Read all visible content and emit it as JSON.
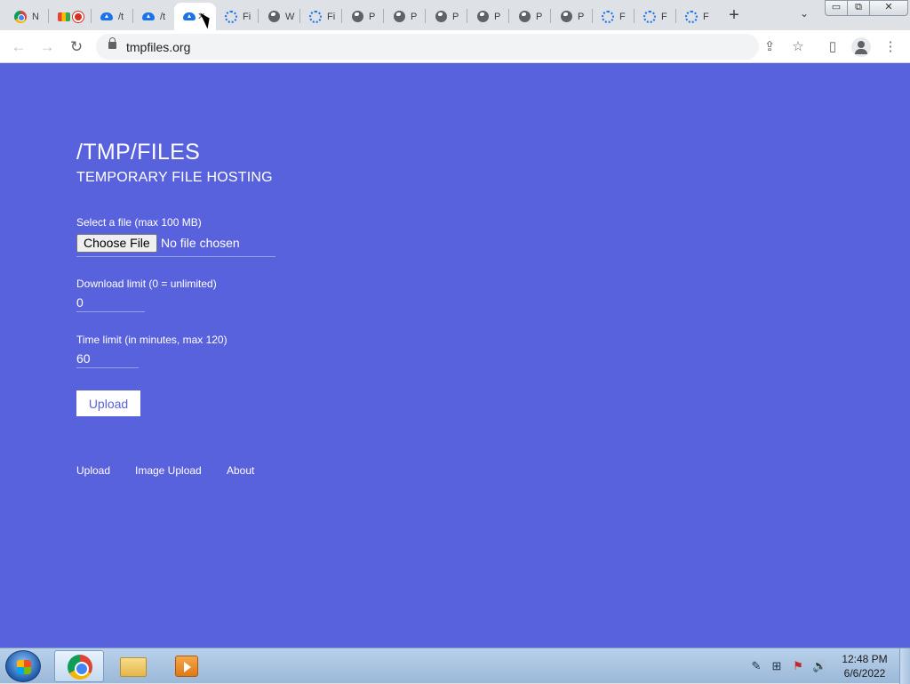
{
  "browser": {
    "tabs": [
      {
        "icon": "chrome-icon",
        "title": "N"
      },
      {
        "icon": "meet-icon",
        "title": ""
      },
      {
        "icon": "cloud-upload-icon",
        "title": "/t"
      },
      {
        "icon": "cloud-upload-icon",
        "title": "/t"
      },
      {
        "icon": "cloud-upload-icon",
        "title": "",
        "active": true,
        "close": "✕"
      },
      {
        "icon": "loading-icon",
        "title": "Fi"
      },
      {
        "icon": "globe-icon",
        "title": "W"
      },
      {
        "icon": "loading-icon",
        "title": "Fi"
      },
      {
        "icon": "globe-icon",
        "title": "P"
      },
      {
        "icon": "globe-icon",
        "title": "P"
      },
      {
        "icon": "globe-icon",
        "title": "P"
      },
      {
        "icon": "globe-icon",
        "title": "P"
      },
      {
        "icon": "globe-icon",
        "title": "P"
      },
      {
        "icon": "globe-icon",
        "title": "P"
      },
      {
        "icon": "loading-icon",
        "title": "F"
      },
      {
        "icon": "loading-icon",
        "title": "F"
      },
      {
        "icon": "loading-icon",
        "title": "F"
      }
    ],
    "new_tab": "+",
    "tab_search": "⌄",
    "window_controls": {
      "minimize": "▭",
      "restore": "⧉",
      "close": "✕"
    },
    "nav": {
      "back": "←",
      "forward": "→",
      "reload": "↻"
    },
    "url": "tmpfiles.org",
    "toolbar_icons": {
      "share": "⇪",
      "bookmark": "☆",
      "sidepanel": "▯",
      "menu": "⋮"
    }
  },
  "page": {
    "title": "/TMP/FILES",
    "subtitle": "TEMPORARY FILE HOSTING",
    "file_label": "Select a file (max 100 MB)",
    "choose_file_label": "Choose File",
    "no_file_text": "No file chosen",
    "download_limit_label": "Download limit (0 = unlimited)",
    "download_limit_value": "0",
    "time_limit_label": "Time limit (in minutes, max 120)",
    "time_limit_value": "60",
    "upload_button": "Upload",
    "footer_links": [
      "Upload",
      "Image Upload",
      "About"
    ],
    "colors": {
      "background": "#5862dd",
      "text": "#ffffff"
    }
  },
  "taskbar": {
    "apps": [
      "start-icon",
      "chrome-icon",
      "explorer-icon",
      "media-player-icon"
    ],
    "tray_icons": {
      "pen": "✎",
      "network": "⊞",
      "flag": "⚑",
      "volume": "🔊"
    },
    "clock_time": "12:48 PM",
    "clock_date": "6/6/2022"
  }
}
